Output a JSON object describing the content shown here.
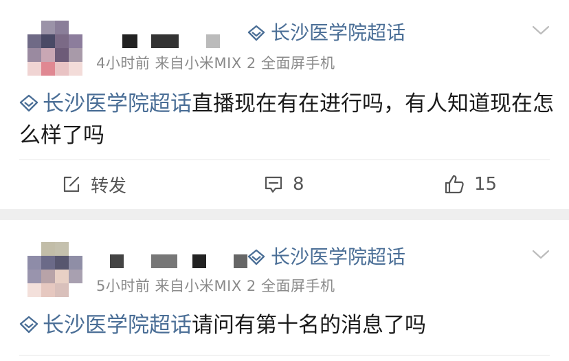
{
  "posts": [
    {
      "topic": "长沙医学院超话",
      "meta": "4小时前  来自小米MIX 2 全面屏手机",
      "content_topic": "长沙医学院超话",
      "content_text": "直播现在有在进行吗，有人知道现在怎么样了吗",
      "actions": {
        "repost_label": "转发",
        "comment_count": "8",
        "like_count": "15"
      }
    },
    {
      "topic": "长沙医学院超话",
      "meta": "5小时前  来自小米MIX 2 全面屏手机",
      "content_topic": "长沙医学院超话",
      "content_text": "请问有第十名的消息了吗"
    }
  ],
  "icons": {
    "topic": "diamond-icon",
    "menu": "chevron-down-icon",
    "repost": "share-icon",
    "comment": "comment-icon",
    "like": "thumbs-up-icon"
  },
  "colors": {
    "topic_link": "#4a6e96",
    "meta_text": "#8a8a8a",
    "separator": "#efefef"
  }
}
